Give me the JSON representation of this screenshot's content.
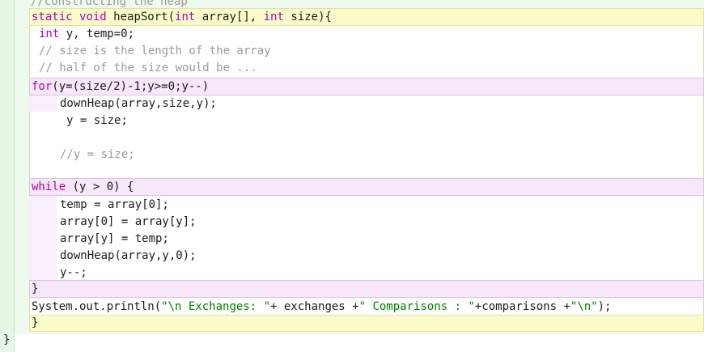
{
  "lines": {
    "l0": "//constructing the heap",
    "l1a": "static",
    "l1b": " ",
    "l1c": "void",
    "l1d": " heapSort(",
    "l1e": "int",
    "l1f": " array[], ",
    "l1g": "int",
    "l1h": " size){",
    "l2a": "int",
    "l2b": " y, temp=0;",
    "l3": "// size is the length of the array",
    "l4": "// half of the size would be ...",
    "l5a": "for",
    "l5b": "(y=(size/2)-1;y>=0;y--)",
    "l6": "downHeap(array,size,y);",
    "l7": "y = size;",
    "l8": "//y = size;",
    "l9a": "while",
    "l9b": " (y > 0) {",
    "l10": "temp = array[0];",
    "l11": "array[0] = array[y];",
    "l12": "array[y] = temp;",
    "l13": "downHeap(array,y,0);",
    "l14": "y--;",
    "l15": "}",
    "l16a": "System.out.println(",
    "l16b": "\"\\n Exchanges: \"",
    "l16c": "+ exchanges +",
    "l16d": "\" Comparisons : \"",
    "l16e": "+comparisons +",
    "l16f": "\"\\n\"",
    "l16g": ");",
    "l17": "}",
    "l18": "}"
  }
}
